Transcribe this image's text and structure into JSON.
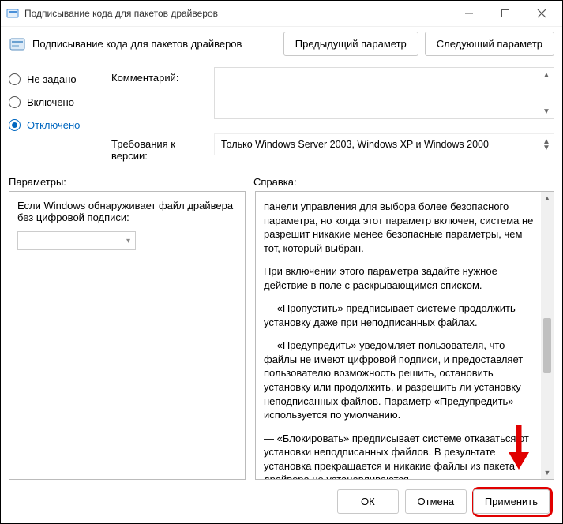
{
  "titlebar": {
    "title": "Подписывание кода для пакетов драйверов"
  },
  "header": {
    "title": "Подписывание кода для пакетов драйверов",
    "prev": "Предыдущий параметр",
    "next": "Следующий параметр"
  },
  "radios": {
    "not_configured": "Не задано",
    "enabled": "Включено",
    "disabled": "Отключено",
    "selected": "disabled"
  },
  "info": {
    "comment_label": "Комментарий:",
    "req_label": "Требования к версии:",
    "req_value": "Только Windows Server 2003, Windows XP и Windows 2000"
  },
  "section_labels": {
    "options": "Параметры:",
    "help": "Справка:"
  },
  "options": {
    "text": "Если Windows обнаруживает файл драйвера без цифровой подписи:"
  },
  "help": {
    "p1": "панели управления для выбора более безопасного параметра, но когда этот параметр включен, система не разрешит никакие менее безопасные параметры, чем тот, который выбран.",
    "p2": "При включении этого параметра задайте нужное действие в поле с раскрывающимся списком.",
    "p3": "—   «Пропустить» предписывает системе продолжить установку даже при неподписанных файлах.",
    "p4": "—   «Предупредить» уведомляет пользователя, что файлы не имеют цифровой подписи, и предоставляет пользователю возможность решить, остановить установку или продолжить, и разрешить ли установку неподписанных файлов. Параметр «Предупредить» используется по умолчанию.",
    "p5": "—   «Блокировать» предписывает системе отказаться от установки неподписанных файлов. В результате установка прекращается и никакие файлы из пакета драйвера не устанавливаются."
  },
  "buttons": {
    "ok": "ОК",
    "cancel": "Отмена",
    "apply": "Применить"
  },
  "annot": {
    "color": "#e10000"
  }
}
